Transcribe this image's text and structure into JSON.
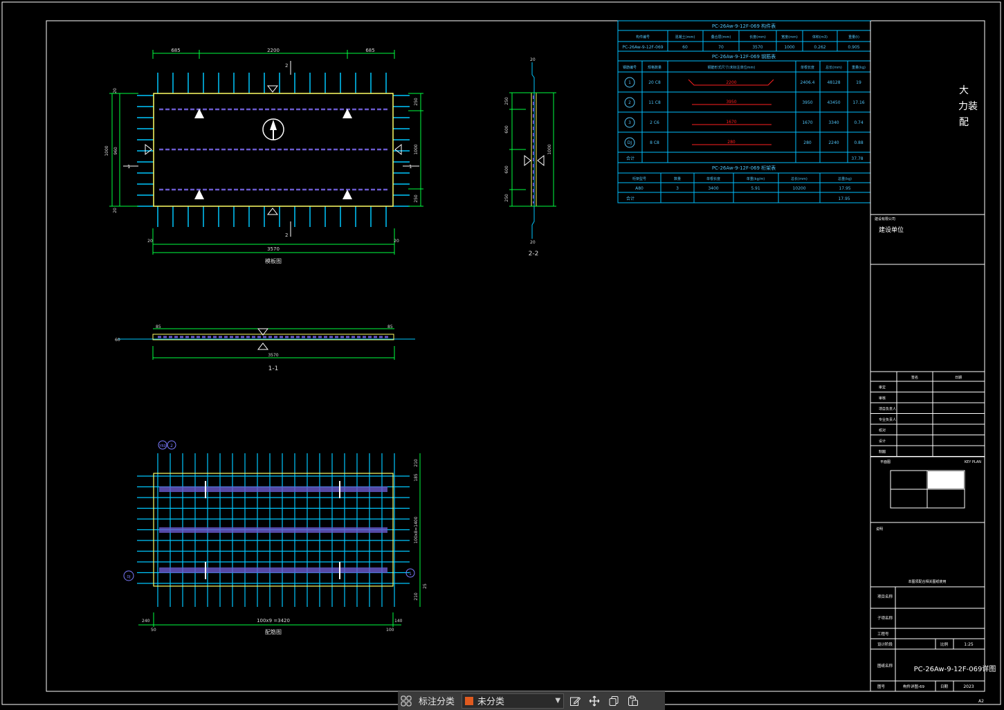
{
  "colors": {
    "background": "#000000",
    "frame": "#ffffff",
    "dimension": "#00ff40",
    "rebar": "#00c8ff",
    "slab_outline": "#ffff66",
    "lattice": "#6a5acd",
    "table_line": "#00bfff",
    "table_text": "#4fc3f7",
    "accent_red": "#ff2020",
    "toolbar_swatch": "#e05a1f"
  },
  "plan_view": {
    "dim_top": [
      "685",
      "2200",
      "685"
    ],
    "dim_bottom": "3570",
    "dim_ends": [
      "20",
      "20"
    ],
    "dim_left_total": "1000",
    "dim_left_inner": "960",
    "dim_left_small": [
      "20",
      "20"
    ],
    "dim_right": [
      "250",
      "1000",
      "250"
    ],
    "cut_marks": [
      "2",
      "2",
      "1",
      "1"
    ],
    "title": "模板图"
  },
  "section_11": {
    "dim_left": "85",
    "dim_right": "85",
    "dim_total": "3570",
    "side": "60",
    "title": "1-1"
  },
  "section_22": {
    "dim_top": "20",
    "dims_left": [
      "250",
      "600",
      "600",
      "250"
    ],
    "dim_right": "1000",
    "dim_bottom": "20",
    "title": "2-2"
  },
  "rebar_view": {
    "tags": [
      "YR0",
      "2",
      "DJ",
      "1"
    ],
    "dim_bottom": "100x9 =3420",
    "dims_bottom_small": [
      "240",
      "50",
      "100",
      "140"
    ],
    "dims_right": [
      "210",
      "185",
      "100x8=1400",
      "25",
      "210"
    ],
    "title": "配筋图"
  },
  "table_component": {
    "title": "PC-26Aw-9-12F-069 构件表",
    "headers": [
      "构件编号",
      "混凝土(mm)",
      "叠合层(mm)",
      "长度(mm)",
      "宽度(mm)",
      "体积(m3)",
      "重量(t)"
    ],
    "row": [
      "PC-26Aw-9-12F-069",
      "60",
      "70",
      "3570",
      "1000",
      "0.262",
      "0.905"
    ]
  },
  "table_rebar": {
    "title": "PC-26Aw-9-12F-069 钢筋表",
    "headers": [
      "钢筋编号",
      "规格数量",
      "钢筋形式尺寸(未标注单位mm)",
      "单根长度",
      "总长(mm)",
      "重量(kg)"
    ],
    "rows": [
      {
        "no": "1",
        "spec": "20 C8",
        "shape": "2200",
        "len": "2406.4",
        "total": "48128",
        "weight": "19"
      },
      {
        "no": "2",
        "spec": "11 C8",
        "shape": "3950",
        "len": "3950",
        "total": "43450",
        "weight": "17.16"
      },
      {
        "no": "3",
        "spec": "2 C6",
        "shape": "1670",
        "len": "1670",
        "total": "3340",
        "weight": "0.74"
      },
      {
        "no": "DJ",
        "spec": "8 C8",
        "shape": "280",
        "len": "280",
        "total": "2240",
        "weight": "0.88"
      }
    ],
    "sum_label": "合计",
    "sum": "37.78"
  },
  "table_truss": {
    "title": "PC-26Aw-9-12F-069 桁架表",
    "headers": [
      "桁架型号",
      "数量",
      "单根长度",
      "单重(kg/m)",
      "总长(mm)",
      "总重(kg)"
    ],
    "row": [
      "A80",
      "3",
      "3400",
      "5.91",
      "10200",
      "17.95"
    ],
    "sum_label": "合计",
    "sum": "17.95"
  },
  "title_block": {
    "company": "大力装配",
    "company_note": "建设有限公司",
    "client_label": "建设单位",
    "role_header": [
      "签名",
      "日期"
    ],
    "roles": [
      "审定",
      "审核",
      "项目负责人",
      "专业负责人",
      "校对",
      "设计",
      "制图"
    ],
    "key_plan_left": "平面图",
    "key_plan_right": "KEY PLAN",
    "note_label": "说明",
    "note_text": "本图须配合相关图纸使用",
    "project_name_label": "项目名称",
    "sub_project_label": "子项名称",
    "project_no_label": "工程号",
    "stage_label": "设计阶段",
    "scale_label": "比例",
    "scale": "1:25",
    "drawing_name_label": "图纸名称",
    "drawing_name": "PC-26Aw-9-12F-069详图",
    "drawing_no_label": "图号",
    "drawing_no": "构件详图-69",
    "date_label": "日期",
    "date": "2023",
    "sheet": "A2"
  },
  "toolbar": {
    "label": "标注分类",
    "select_value": "未分类",
    "icons": [
      "grid-icon",
      "edit-icon",
      "move-icon",
      "copy-icon",
      "paste-icon"
    ]
  }
}
